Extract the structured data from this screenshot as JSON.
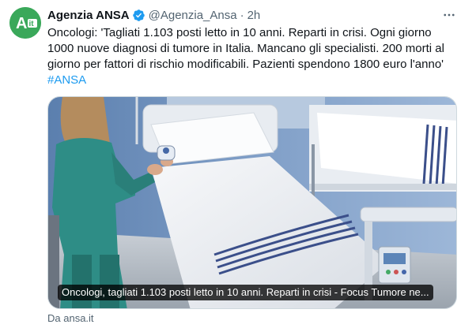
{
  "author": {
    "avatar_text": "A it",
    "name": "Agenzia ANSA",
    "handle": "@Agenzia_Ansa",
    "separator": "·",
    "time": "2h",
    "verified": true
  },
  "tweet": {
    "text": "Oncologi: 'Tagliati 1.103 posti letto in 10 anni. Reparti in crisi. Ogni giorno 1000 nuove diagnosi di tumore in Italia. Mancano gli specialisti. 200 morti al giorno per fattori di rischio modificabili. Pazienti spendono 1800 euro l'anno' ",
    "hashtag": "#ANSA"
  },
  "card": {
    "title": "Oncologi, tagliati 1.103 posti letto in 10 anni. Reparti in crisi - Focus Tumore ne...",
    "image_alt": "hospital-ward-photo"
  },
  "source": {
    "label": "Da ansa.it"
  },
  "icons": {
    "verified": "verified-badge-icon",
    "more": "more-options-icon"
  },
  "colors": {
    "link": "#1d9bf0",
    "verified": "#1d9bf0",
    "secondary_text": "#536471",
    "avatar_bg": "#3aa85a"
  }
}
